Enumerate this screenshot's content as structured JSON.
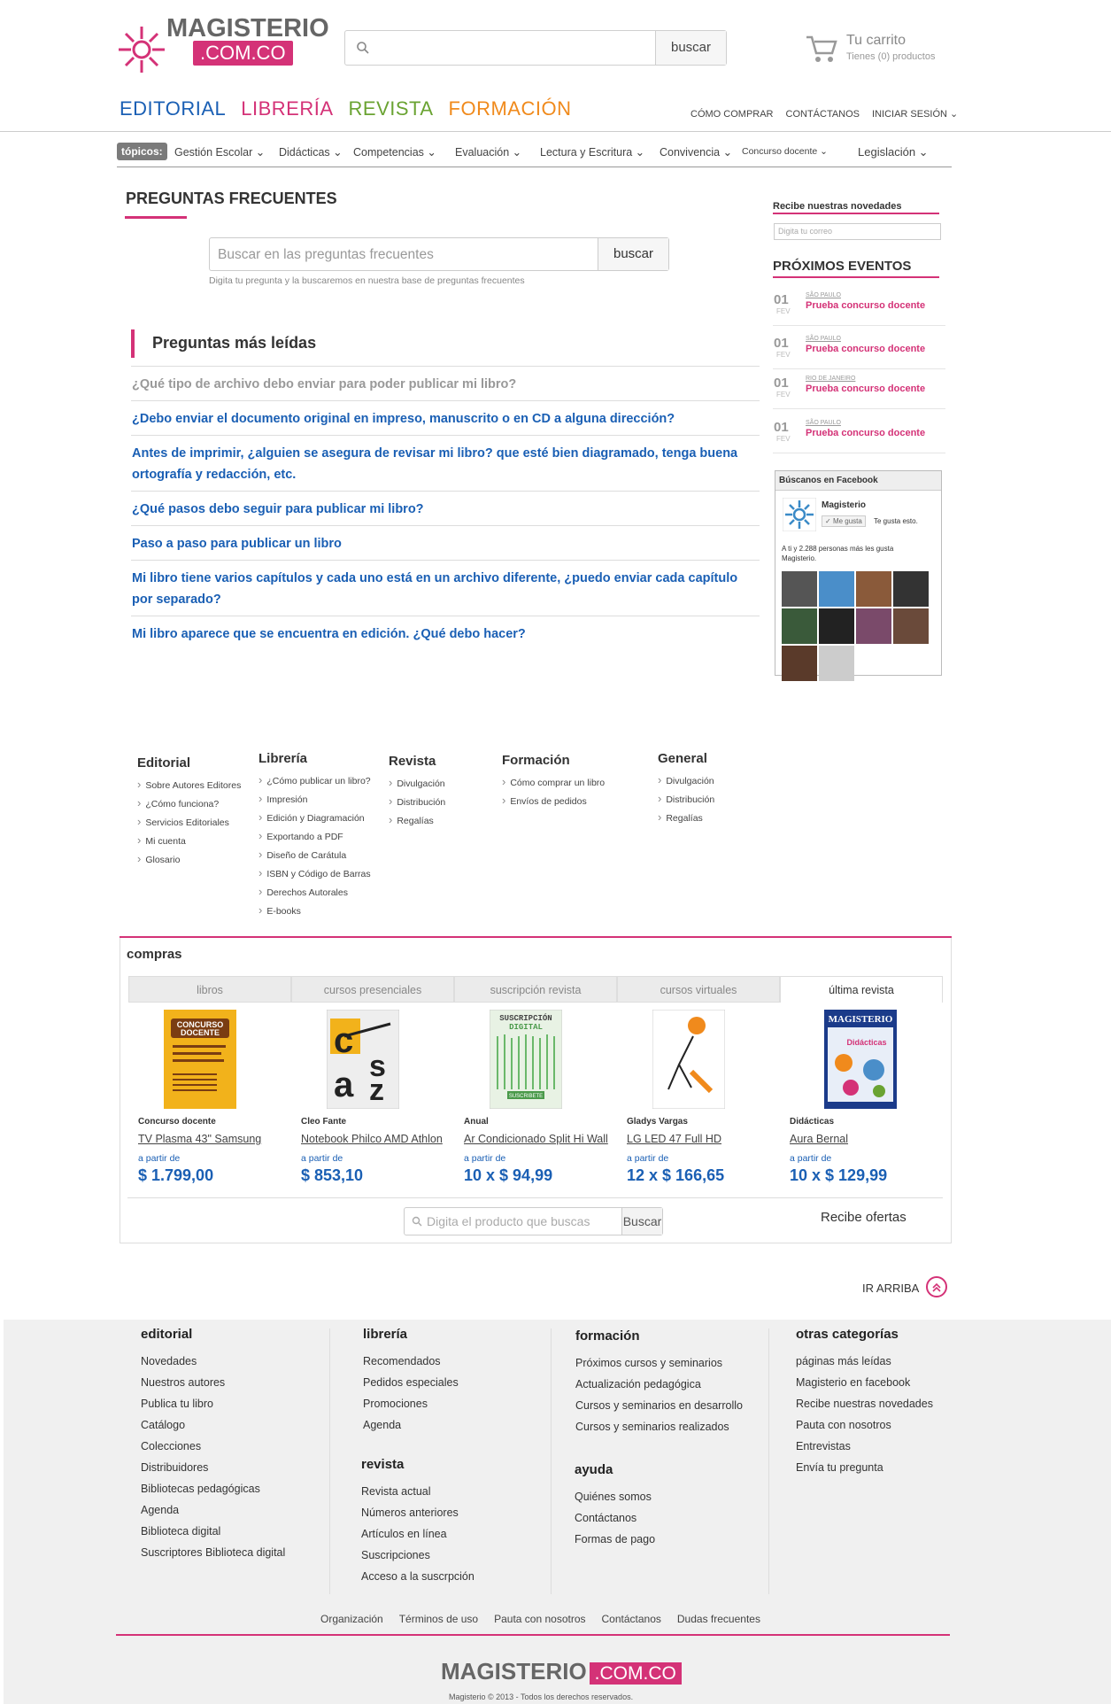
{
  "header": {
    "logo_main": "MAGISTERIO",
    "logo_sub": ".COM.CO",
    "search_placeholder": "",
    "search_button": "buscar",
    "cart_title": "Tu carrito",
    "cart_sub": "Tienes (0) productos"
  },
  "main_nav": [
    {
      "label": "EDITORIAL",
      "color": "#1a5fb4"
    },
    {
      "label": "LIBRERÍA",
      "color": "#d43277"
    },
    {
      "label": "REVISTA",
      "color": "#6aa332"
    },
    {
      "label": "FORMACIÓN",
      "color": "#f08a1c"
    }
  ],
  "user_nav": [
    "CÓMO COMPRAR",
    "CONTÁCTANOS",
    "INICIAR SESIÓN"
  ],
  "topics": {
    "label": "tópicos:",
    "items": [
      "Gestión Escolar",
      "Didácticas",
      "Competencias",
      "Evaluación",
      "Lectura y Escritura",
      "Convivencia",
      "Concurso docente",
      "Legislación"
    ]
  },
  "faq": {
    "title": "PREGUNTAS FRECUENTES",
    "search_placeholder": "Buscar en las preguntas frecuentes",
    "search_button": "buscar",
    "hint": "Digita tu pregunta y la buscaremos en nuestra base de preguntas frecuentes",
    "most_read_title": "Preguntas más leídas",
    "questions": [
      "¿Qué tipo de archivo debo enviar para poder publicar mi libro?",
      "¿Debo enviar el documento original en impreso, manuscrito o en CD a alguna dirección?",
      "Antes de imprimir, ¿alguien se asegura de revisar mi libro? que esté bien diagramado, tenga buena ortografía y redacción, etc.",
      "¿Qué pasos debo seguir para publicar mi libro?",
      "Paso a paso para publicar un libro",
      "Mi libro tiene varios capítulos y cada uno está en un archivo diferente, ¿puedo enviar cada capítulo por separado?",
      "Mi libro aparece que se encuentra en edición. ¿Qué debo hacer?"
    ]
  },
  "sidebar": {
    "newsletter_title": "Recibe nuestras novedades",
    "newsletter_placeholder": "Digita tu correo",
    "events_title": "PRÓXIMOS EVENTOS",
    "events": [
      {
        "day": "01",
        "month": "FEV",
        "place": "SÃO PAULO",
        "title": "Prueba concurso docente"
      },
      {
        "day": "01",
        "month": "FEV",
        "place": "SÃO PAULO",
        "title": "Prueba concurso docente"
      },
      {
        "day": "01",
        "month": "FEV",
        "place": "RIO DE JANEIRO",
        "title": "Prueba concurso docente"
      },
      {
        "day": "01",
        "month": "FEV",
        "place": "SÃO PAULO",
        "title": "Prueba concurso docente"
      }
    ],
    "facebook": {
      "title": "Búscanos en Facebook",
      "page_name": "Magisterio",
      "like_button": "Me gusta",
      "like_text": "Te gusta esto.",
      "count_text": "A ti y 2.288 personas más les gusta Magisterio."
    }
  },
  "footer_links": [
    {
      "title": "Editorial",
      "items": [
        "Sobre Autores Editores",
        "¿Cómo funciona?",
        "Servicios Editoriales",
        "Mi cuenta",
        "Glosario"
      ]
    },
    {
      "title": "Librería",
      "items": [
        "¿Cómo publicar un libro?",
        "Impresión",
        "Edición y Diagramación",
        "Exportando a PDF",
        "Diseño de Carátula",
        "ISBN y Código de Barras",
        "Derechos Autorales",
        "E-books"
      ]
    },
    {
      "title": "Revista",
      "items": [
        "Divulgación",
        "Distribución",
        "Regalías"
      ]
    },
    {
      "title": "Formación",
      "items": [
        "Cómo comprar un libro",
        "Envíos de pedidos"
      ]
    },
    {
      "title": "General",
      "items": [
        "Divulgación",
        "Distribución",
        "Regalías"
      ]
    }
  ],
  "compras": {
    "title": "compras",
    "tabs": [
      "libros",
      "cursos presenciales",
      "suscripción revista",
      "cursos virtuales",
      "última revista"
    ],
    "products": [
      {
        "cat": "Concurso docente",
        "name": "TV Plasma 43\" Samsung",
        "from": "a partir de",
        "price": "$ 1.799,00"
      },
      {
        "cat": "Cleo Fante",
        "name": "Notebook Philco AMD Athlon",
        "from": "a partir de",
        "price": "$ 853,10"
      },
      {
        "cat": "Anual",
        "name": "Ar Condicionado Split Hi Wall",
        "from": "a partir de",
        "price": "10 x $ 94,99"
      },
      {
        "cat": "Gladys Vargas",
        "name": "LG LED 47 Full HD",
        "from": "a partir de",
        "price": "12 x $ 166,65"
      },
      {
        "cat": "Didácticas",
        "name": "Aura Bernal",
        "from": "a partir de",
        "price": "10 x $ 129,99"
      }
    ],
    "search_placeholder": "Digita el producto que buscas",
    "search_button": "Buscar",
    "offers": "Recibe ofertas",
    "book_cover_title": "CONCURSO DOCENTE",
    "sub_cover": "SUSCRIPCIÓN DIGITAL",
    "sub_button": "SUSCRIBETE",
    "mag_cover": "MAGISTERIO",
    "mag_sub": "Didácticas"
  },
  "ir_arriba": "IR ARRIBA",
  "bottom": {
    "cols": [
      {
        "title": "editorial",
        "items": [
          "Novedades",
          "Nuestros autores",
          "Publica tu libro",
          "Catálogo",
          "Colecciones",
          "Distribuidores",
          "Bibliotecas pedagógicas",
          "Agenda",
          "Biblioteca digital",
          "Suscriptores Biblioteca digital"
        ]
      },
      {
        "title": "librería",
        "items": [
          "Recomendados",
          "Pedidos especiales",
          "Promociones",
          "Agenda"
        ]
      },
      {
        "title": "revista",
        "items": [
          "Revista actual",
          "Números anteriores",
          "Artículos en línea",
          "Suscripciones",
          "Acceso a la suscrpción"
        ]
      },
      {
        "title": "formación",
        "items": [
          "Próximos cursos y seminarios",
          "Actualización pedagógica",
          "Cursos y seminarios en desarrollo",
          "Cursos y seminarios realizados"
        ]
      },
      {
        "title": "ayuda",
        "items": [
          "Quiénes somos",
          "Contáctanos",
          "Formas de pago"
        ]
      },
      {
        "title": "otras categorías",
        "items": [
          "páginas más leídas",
          "Magisterio en facebook",
          "Recibe nuestras novedades",
          "Pauta con nosotros",
          "Entrevistas",
          "Envía tu pregunta"
        ]
      }
    ],
    "legal": [
      "Organización",
      "Términos de uso",
      "Pauta con nosotros",
      "Contáctanos",
      "Dudas frecuentes"
    ],
    "logo_main": "MAGISTERIO",
    "logo_sub": ".COM.CO",
    "copyright": "Magisterio © 2013 - Todos los derechos reservados."
  }
}
